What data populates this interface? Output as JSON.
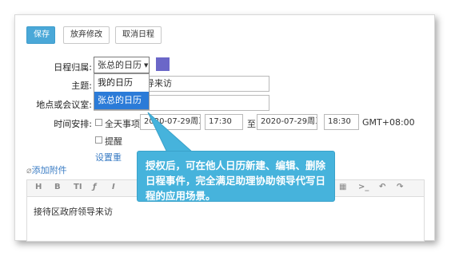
{
  "toolbar_buttons": {
    "save": "保存",
    "discard": "放弃修改",
    "cancel_event": "取消日程"
  },
  "form": {
    "calendar_label": "日程归属:",
    "calendar_value": "张总的日历",
    "calendar_color": "#6b67c8",
    "calendar_options": [
      "我的日历",
      "张总的日历"
    ],
    "subject_label": "主题:",
    "subject_value_visible": "导来访",
    "location_label": "地点或会议室:",
    "time_label": "时间安排:",
    "all_day": "全天事项",
    "start_date": "2020-07-29周三",
    "start_time": "17:30",
    "to": "至",
    "end_date": "2020-07-29周三",
    "end_time": "18:30",
    "timezone": "GMT+08:00",
    "reminder": "提醒",
    "settings_link": "设置重",
    "attachment_link": "添加附件"
  },
  "editor": {
    "content": "接待区政府领导来访"
  },
  "callout": {
    "text": "授权后，可在他人日历新建、编辑、删除日程事件，完全满足助理协助领导代写日程的应用场景。",
    "color": "#46b3dc"
  }
}
